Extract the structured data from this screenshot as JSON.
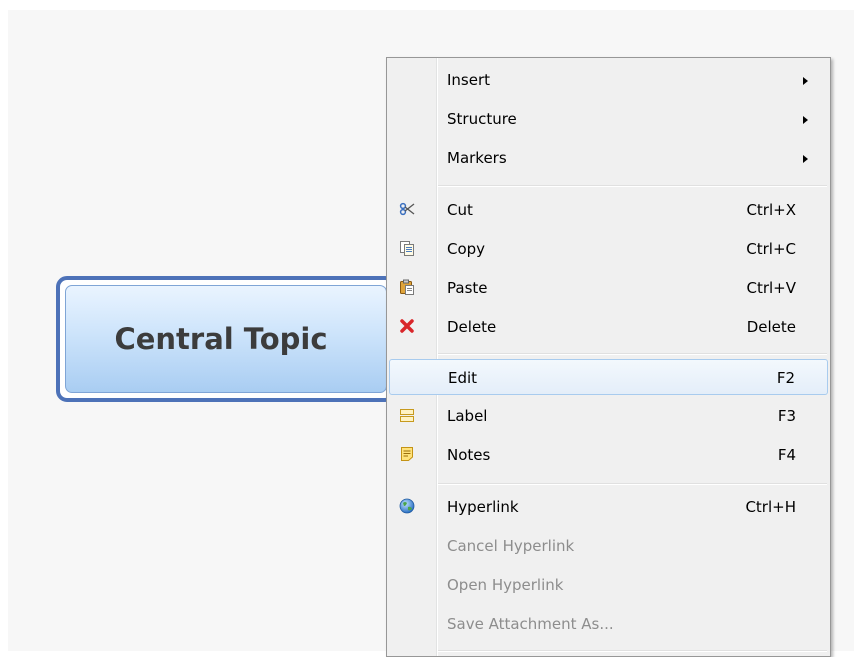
{
  "topic": {
    "label": "Central Topic"
  },
  "menu": {
    "items": [
      {
        "label": "Insert",
        "shortcut": "",
        "icon": ""
      },
      {
        "label": "Structure",
        "shortcut": "",
        "icon": ""
      },
      {
        "label": "Markers",
        "shortcut": "",
        "icon": ""
      },
      {
        "label": "Cut",
        "shortcut": "Ctrl+X",
        "icon": "scissors-icon"
      },
      {
        "label": "Copy",
        "shortcut": "Ctrl+C",
        "icon": "copy-icon"
      },
      {
        "label": "Paste",
        "shortcut": "Ctrl+V",
        "icon": "paste-icon"
      },
      {
        "label": "Delete",
        "shortcut": "Delete",
        "icon": "delete-icon"
      },
      {
        "label": "Edit",
        "shortcut": "F2",
        "icon": ""
      },
      {
        "label": "Label",
        "shortcut": "F3",
        "icon": "label-icon"
      },
      {
        "label": "Notes",
        "shortcut": "F4",
        "icon": "notes-icon"
      },
      {
        "label": "Hyperlink",
        "shortcut": "Ctrl+H",
        "icon": "globe-icon"
      },
      {
        "label": "Cancel Hyperlink",
        "shortcut": "",
        "icon": ""
      },
      {
        "label": "Open Hyperlink",
        "shortcut": "",
        "icon": ""
      },
      {
        "label": "Save Attachment As...",
        "shortcut": "",
        "icon": ""
      }
    ]
  },
  "colors": {
    "topic_border": "#4d72b8",
    "topic_fill_top": "#eaf4ff",
    "topic_fill_bottom": "#a9cdf2",
    "menu_bg": "#f0f0f0",
    "highlight_border": "#a8cbee",
    "disabled_text": "#8d8d8d",
    "delete_red": "#d9262a"
  }
}
